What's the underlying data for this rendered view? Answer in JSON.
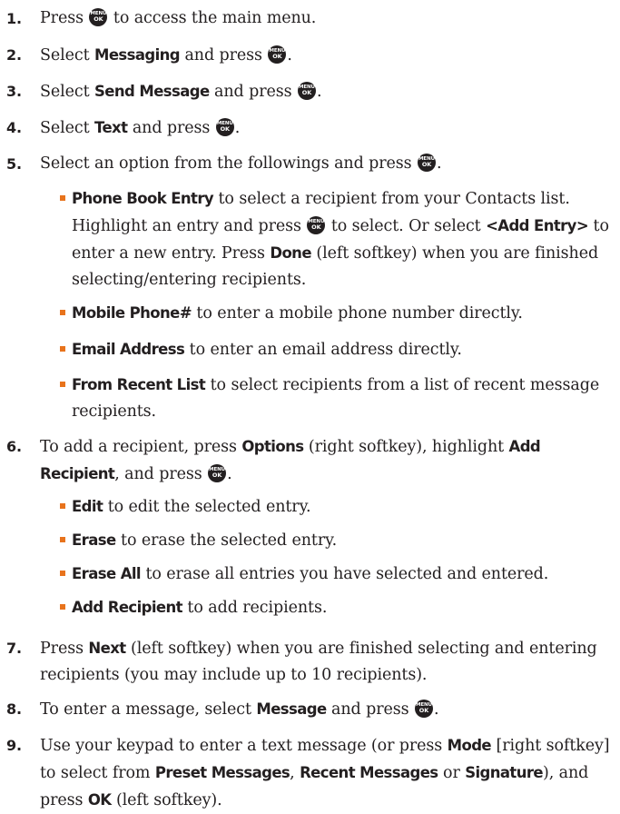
{
  "key_icon": {
    "top": "MENU",
    "bottom": "OK"
  },
  "colors": {
    "bullet": "#e8731c",
    "text": "#231f20"
  },
  "steps": [
    {
      "num": "1.",
      "parts": [
        "Press ",
        "{key}",
        " to access the main menu."
      ]
    },
    {
      "num": "2.",
      "parts": [
        "Select ",
        "Messaging",
        " and press ",
        "{key}",
        "."
      ]
    },
    {
      "num": "3.",
      "parts": [
        "Select ",
        "Send Message",
        " and press ",
        "{key}",
        "."
      ]
    },
    {
      "num": "4.",
      "parts": [
        "Select ",
        "Text",
        " and press ",
        "{key}",
        "."
      ]
    },
    {
      "num": "5.",
      "parts": [
        "Select an option from the followings and press ",
        "{key}",
        "."
      ]
    },
    {
      "num": "6.",
      "parts": [
        "To add a recipient, press ",
        "Options",
        " (right softkey), highlight ",
        "Add Recipient",
        ", and press ",
        "{key}",
        "."
      ]
    },
    {
      "num": "7.",
      "parts": [
        "Press ",
        "Next",
        " (left softkey) when you are finished selecting and entering recipients (you may include up to 10 recipients)."
      ]
    },
    {
      "num": "8.",
      "parts": [
        "To enter a message, select ",
        "Message",
        " and press ",
        "{key}",
        "."
      ]
    },
    {
      "num": "9.",
      "parts": [
        "Use your keypad to enter a text message (or press ",
        "Mode",
        " [right softkey] to select from ",
        "Preset Messages",
        ", ",
        "Recent Messages",
        " or ",
        "Signature",
        "), and press ",
        "OK",
        " (left softkey)."
      ]
    }
  ],
  "step5_options": [
    {
      "parts": [
        "Phone Book Entry",
        " to select a recipient from your Contacts list. Highlight an entry and press ",
        "{key}",
        " to select. Or select ",
        "<Add Entry>",
        " to enter a new entry. Press ",
        "Done",
        " (left softkey) when you are finished selecting/entering recipients."
      ]
    },
    {
      "parts": [
        "Mobile Phone#",
        " to enter a mobile phone number directly."
      ]
    },
    {
      "parts": [
        "Email Address",
        " to enter an email address directly."
      ]
    },
    {
      "parts": [
        "From Recent List",
        " to select recipients from a list of recent message recipients."
      ]
    }
  ],
  "step6_options": [
    {
      "parts": [
        "Edit",
        " to edit the selected entry."
      ]
    },
    {
      "parts": [
        "Erase",
        " to erase the selected entry."
      ]
    },
    {
      "parts": [
        "Erase All",
        " to erase all entries you have selected and entered."
      ]
    },
    {
      "parts": [
        "Add Recipient",
        " to add recipients."
      ]
    }
  ]
}
